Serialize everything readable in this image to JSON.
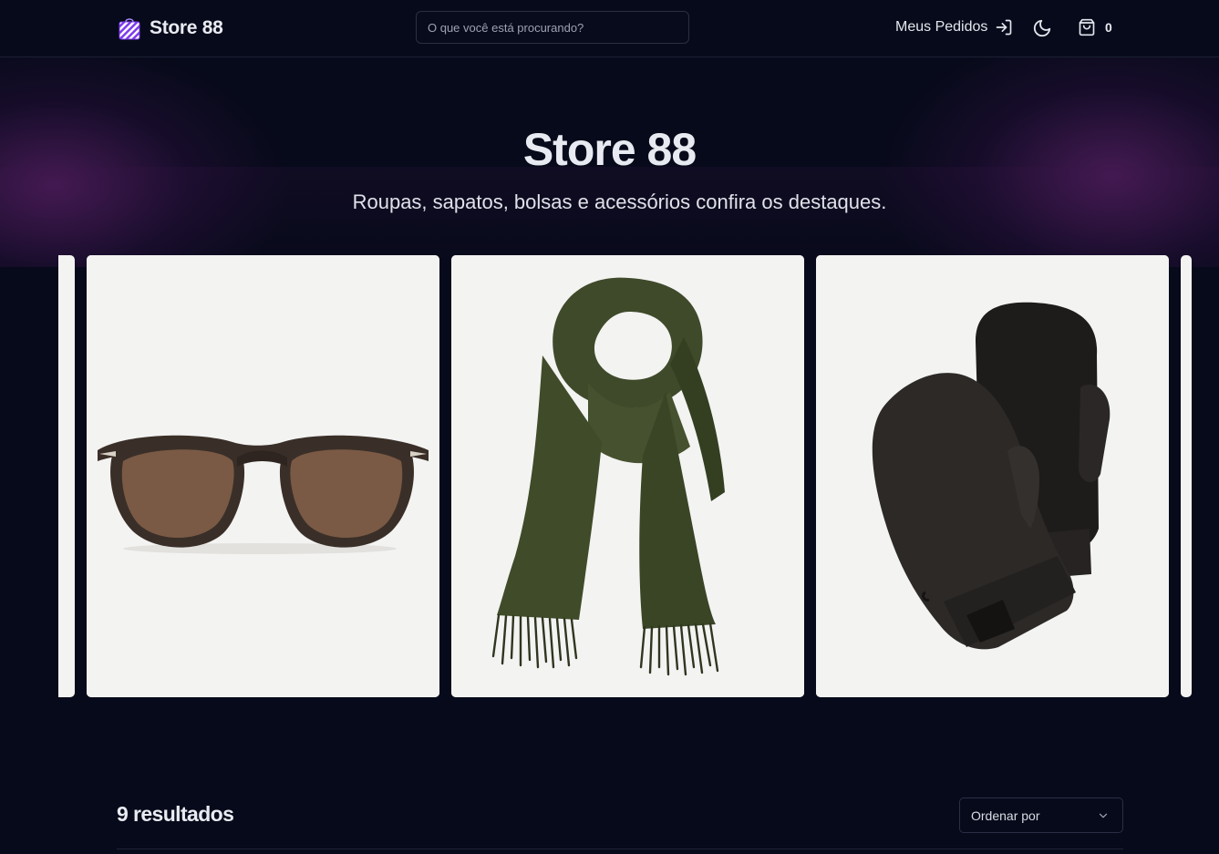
{
  "header": {
    "brand_name": "Store 88",
    "brand_icon": "shopping-bag-striped-icon",
    "search_placeholder": "O que você está procurando?",
    "orders_label": "Meus Pedidos",
    "orders_icon": "sign-in-arrow-icon",
    "theme_icon": "moon-icon",
    "cart_icon": "shopping-bag-icon",
    "cart_count": "0"
  },
  "hero": {
    "title": "Store 88",
    "subtitle": "Roupas, sapatos, bolsas e acessórios confira os destaques."
  },
  "carousel": {
    "slides": [
      {
        "image": "sunglasses-product-image"
      },
      {
        "image": "green-scarf-product-image"
      },
      {
        "image": "black-mittens-product-image"
      }
    ]
  },
  "results": {
    "count_label": "9 resultados",
    "sort_label": "Ordenar por",
    "sort_icon": "chevron-down-icon"
  },
  "colors": {
    "background": "#070a1a",
    "accent": "#7c3aed",
    "text": "#e8eaf1"
  }
}
